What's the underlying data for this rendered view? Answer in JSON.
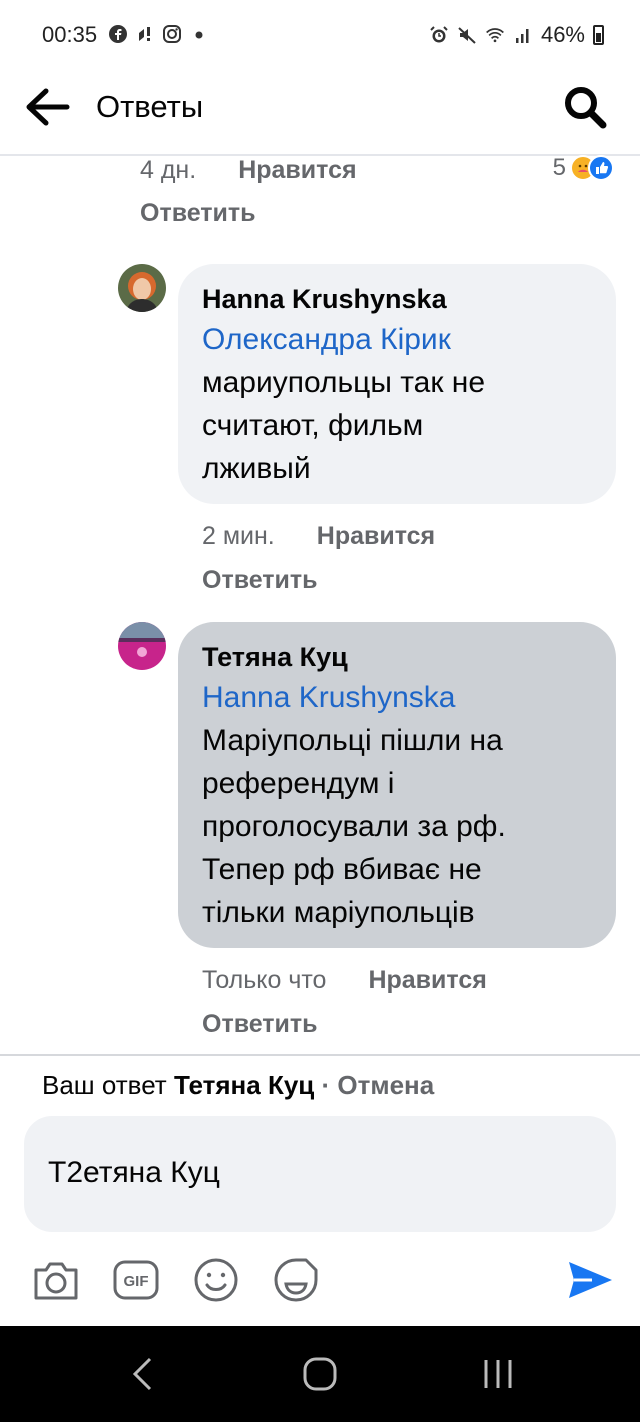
{
  "status_bar": {
    "time": "00:35",
    "left_icons": [
      "facebook-icon",
      "notification-icon",
      "instagram-icon",
      "dot-icon"
    ],
    "right_icons": [
      "alarm-icon",
      "mute-icon",
      "wifi-icon",
      "signal-icon"
    ],
    "battery": "46%"
  },
  "header": {
    "title": "Ответы",
    "back_icon": "arrow-left-icon",
    "search_icon": "search-icon"
  },
  "top_comment": {
    "timestamp": "4 дн.",
    "like_label": "Нравится",
    "reply_label": "Ответить",
    "reaction_count": "5"
  },
  "replies": [
    {
      "author": "Hanna Krushynska",
      "mention": "Олександра Кірик",
      "text": "мариупольцы так не\nсчитают, фильм\nлживый",
      "timestamp": "2 мин.",
      "like_label": "Нравится",
      "reply_label": "Ответить"
    },
    {
      "author": "Тетяна Куц",
      "mention": "Hanna Krushynska",
      "text": "Маріупольці пішли на\nреферендум і\nпроголосували за рф.\nТепер рф вбиває не\nтільки маріупольців",
      "timestamp": "Только что",
      "like_label": "Нравится",
      "reply_label": "Ответить"
    }
  ],
  "composer": {
    "reply_prefix": "Ваш ответ",
    "reply_to_name": "Тетяна Куц",
    "separator": " · ",
    "cancel_label": "Отмена",
    "input_value": "Т2етяна Куц",
    "tools": [
      "camera-icon",
      "gif-icon",
      "emoji-icon",
      "sticker-icon"
    ],
    "send_icon": "send-icon"
  },
  "colors": {
    "link_blue": "#1e66c8",
    "send_blue": "#1877f2",
    "secondary_text": "#65676b",
    "bubble_gray": "#f0f2f5",
    "bubble_highlight": "#ccd0d5"
  }
}
